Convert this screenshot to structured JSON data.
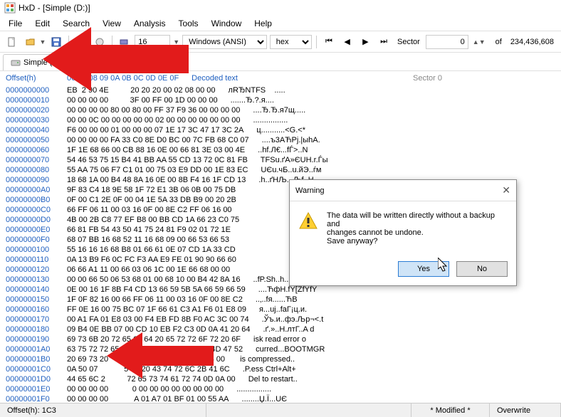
{
  "window": {
    "title": "HxD - [Simple (D:)]"
  },
  "menu": {
    "file": "File",
    "edit": "Edit",
    "search": "Search",
    "view": "View",
    "analysis": "Analysis",
    "tools": "Tools",
    "window": "Window",
    "help": "Help"
  },
  "toolbar": {
    "bytes_per_row": "16",
    "charset": "Windows (ANSI)",
    "base": "hex",
    "sector_label": "Sector",
    "sector_value": "0",
    "of_label": "of",
    "sector_total": "234,436,608"
  },
  "tab": {
    "label": "Simple (D:)"
  },
  "headers": {
    "offset": "Offset(h)",
    "cols": "                     06 07 08 09 0A 0B 0C 0D 0E 0F",
    "decoded": "Decoded text"
  },
  "sector_marker": "Sector 0",
  "rows": [
    {
      "o": "0000000000",
      "h": "EB  2 90 4E          20 20 20 00 02 08 00 00",
      "a": "лRЂNTFS    ....."
    },
    {
      "o": "0000000010",
      "h": "00 00 00 00          3F 00 FF 00 1D 00 00 00",
      "a": ".......Ђ.?.я...."
    },
    {
      "o": "0000000020",
      "h": "00 00 00 00 80 00 80 00 FF 37 F9 36 00 00 00 00",
      "a": "....Ђ.Ђ.я7щ....."
    },
    {
      "o": "0000000030",
      "h": "00 00 0C 00 00 00 00 00 02 00 00 00 00 00 00 00",
      "a": "................"
    },
    {
      "o": "0000000040",
      "h": "F6 00 00 00 01 00 00 00 07 1E 17 3C 47 17 3C 2A",
      "a": "ц...........<G.<*"
    },
    {
      "o": "0000000050",
      "h": "00 00 00 00 FA 33 C0 8E D0 BC 00 7C FB 68 C0 07",
      "a": "....ъ3АЋРј.|ыhА."
    },
    {
      "o": "0000000060",
      "h": "1F 1E 68 66 00 CB 88 16 0E 00 66 81 3E 03 00 4E",
      "a": "..hf.Л€...fЃ>..N"
    },
    {
      "o": "0000000070",
      "h": "54 46 53 75 15 B4 41 BB AA 55 CD 13 72 0C 81 FB",
      "a": "TFSu.ґA»ЄUН.r.Ѓы"
    },
    {
      "o": "0000000080",
      "h": "55 AA 75 06 F7 C1 01 00 75 03 E9 DD 00 1E 83 EC",
      "a": "UЄu.чБ..u.йЭ..ѓм"
    },
    {
      "o": "0000000090",
      "h": "18 68 1A 00 B4 48 8A 16 0E 00 8B F4 16 1F CD 13",
      "a": ".h..ґHЉ...Љf..Н."
    },
    {
      "o": "00000000A0",
      "h": "9F 83 C4 18 9E 58 1F 72 E1 3B 06 0B 00 75 DB",
      "a": "                 "
    },
    {
      "o": "00000000B0",
      "h": "0F 00 C1 2E 0F 00 04 1E 5A 33 DB B9 00 20 2B",
      "a": "                 "
    },
    {
      "o": "00000000C0",
      "h": "66 FF 06 11 00 03 16 0F 00 8E C2 FF 06 16 00",
      "a": "                 "
    },
    {
      "o": "00000000D0",
      "h": "4B 00 2B C8 77 EF B8 00 BB CD 1A 66 23 C0 75",
      "a": "                 "
    },
    {
      "o": "00000000E0",
      "h": "66 81 FB 54 43 50 41 75 24 81 F9 02 01 72 1E",
      "a": "                 "
    },
    {
      "o": "00000000F0",
      "h": "68 07 BB 16 68 52 11 16 68 09 00 66 53 66 53",
      "a": "                 "
    },
    {
      "o": "0000000100",
      "h": "55 16 16 16 68 B8 01 66 61 0E 07 CD 1A 33 CD",
      "a": "                 "
    },
    {
      "o": "0000000110",
      "h": "0A 13 B9 F6 0C FC F3 AA E9 FE 01 90 90 66 60",
      "a": "                 "
    },
    {
      "o": "0000000120",
      "h": "06 66 A1 11 00 66 03 06 1C 00 1E 66 68 00 00",
      "a": "                 "
    },
    {
      "o": "0000000130",
      "h": "00 00 66 50 06 53 68 01 00 68 10 00 B4 42 8A 16",
      "a": "..fP.Sh..h..ґBЉ."
    },
    {
      "o": "0000000140",
      "h": "0E 00 16 1F 8B F4 CD 13 66 59 5B 5A 66 59 66 59",
      "a": "....ЋфН.fY[ZfYfY"
    },
    {
      "o": "0000000150",
      "h": "1F 0F 82 16 00 66 FF 06 11 00 03 16 0F 00 8E C2",
      "a": "..‚..fя......ЋВ"
    },
    {
      "o": "0000000160",
      "h": "FF 0E 16 00 75 BC 07 1F 66 61 C3 A1 F6 01 E8 09",
      "a": "я...uј..faГ¡ц.и."
    },
    {
      "o": "0000000170",
      "h": "00 A1 FA 01 E8 03 00 F4 EB FD 8B F0 AC 3C 00 74",
      "a": ".Ўъ.и..фэ.Љр¬<.t"
    },
    {
      "o": "0000000180",
      "h": "09 B4 0E BB 07 00 CD 10 EB F2 C3 0D 0A 41 20 64",
      "a": ".ґ.»..Н.лтГ..A d"
    },
    {
      "o": "0000000190",
      "h": "69 73 6B 20 72 65 61 64 20 65 72 72 6F 72 20 6F",
      "a": "isk read error o"
    },
    {
      "o": "00000001A0",
      "h": "63 75 72 72 65 64 00 0D 0A 42 4F 4F 54 4D 47 52",
      "a": "curred...BOOTMGR"
    },
    {
      "o": "00000001B0",
      "h": "20 69 73 20           D 70 72 65 73 73 65 64 00",
      "a": " is compressed.."
    },
    {
      "o": "00000001C0",
      "h": "0A 50 07            5 73 20 43 74 72 6C 2B 41 6C",
      "a": ".P.ess Ctrl+Alt+"
    },
    {
      "o": "00000001D0",
      "h": "44 65 6C 2          72 65 73 74 61 72 74 0D 0A 00",
      "a": "Del to restart.."
    },
    {
      "o": "00000001E0",
      "h": "00 00 00 00           0 00 00 00 00 00 00 00 00",
      "a": "................"
    },
    {
      "o": "00000001F0",
      "h": "00 00 00 00            A 01 A7 01 BF 01 00 55 AA",
      "a": "........Џ.Ї...UЄ"
    }
  ],
  "dialog": {
    "title": "Warning",
    "line1": "The data will be written directly without a backup and",
    "line2": "changes cannot be undone.",
    "line3": "Save anyway?",
    "yes": "Yes",
    "no": "No"
  },
  "status": {
    "offset_label": "Offset(h):",
    "offset_value": "1C3",
    "modified": "* Modified *",
    "mode": "Overwrite"
  },
  "colors": {
    "accent": "#e21b1b"
  }
}
